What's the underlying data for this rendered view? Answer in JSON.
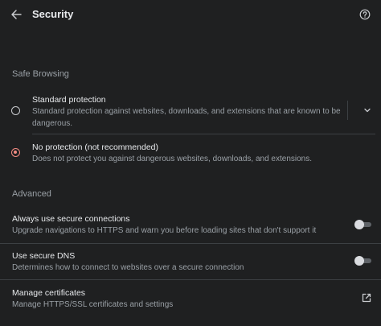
{
  "header": {
    "title": "Security",
    "back_icon": "arrow-left-icon",
    "help_icon": "help-circle-icon"
  },
  "safe_browsing": {
    "heading": "Safe Browsing",
    "options": [
      {
        "title": "Standard protection",
        "description": "Standard protection against websites, downloads, and extensions that are known to be dangerous.",
        "selected": false
      },
      {
        "title": "No protection (not recommended)",
        "description": "Does not protect you against dangerous websites, downloads, and extensions.",
        "selected": true
      }
    ]
  },
  "advanced": {
    "heading": "Advanced",
    "items": [
      {
        "title": "Always use secure connections",
        "description": "Upgrade navigations to HTTPS and warn you before loading sites that don't support it",
        "control": "toggle",
        "enabled": false
      },
      {
        "title": "Use secure DNS",
        "description": "Determines how to connect to websites over a secure connection",
        "control": "toggle",
        "enabled": false
      },
      {
        "title": "Manage certificates",
        "description": "Manage HTTPS/SSL certificates and settings",
        "control": "external-link"
      }
    ]
  },
  "colors": {
    "background": "#1f2021",
    "text_primary": "#e8eaed",
    "text_secondary": "#9aa0a6",
    "accent_radio_selected": "#f28b82",
    "divider": "#3c4043"
  }
}
